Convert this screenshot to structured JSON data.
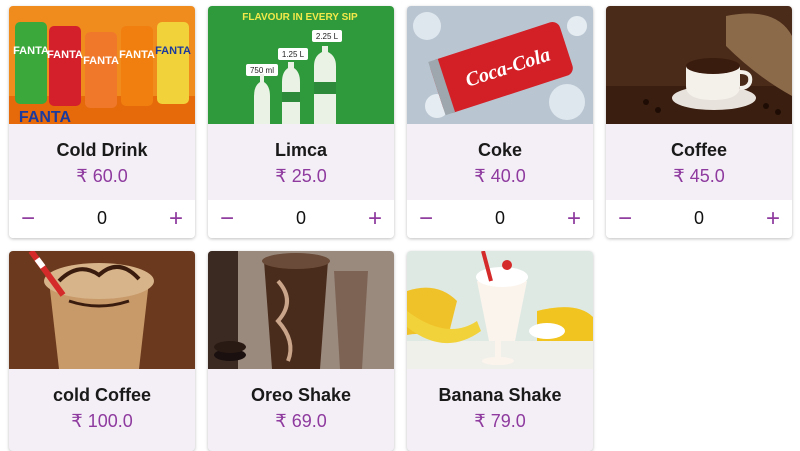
{
  "currency": "₹",
  "products": [
    {
      "name": "Cold Drink",
      "price": "₹ 60.0",
      "qty": "0",
      "image": "fanta-cans-image",
      "img_text": "FANTA"
    },
    {
      "name": "Limca",
      "price": "₹ 25.0",
      "qty": "0",
      "image": "limca-bottles-image",
      "img_text": "FLAVOUR IN EVERY SIP",
      "sizes": [
        "750 ml",
        "1.25 L",
        "2.25 L"
      ]
    },
    {
      "name": "Coke",
      "price": "₹ 40.0",
      "qty": "0",
      "image": "coca-cola-can-image",
      "img_text": "Coca-Cola"
    },
    {
      "name": "Coffee",
      "price": "₹ 45.0",
      "qty": "0",
      "image": "coffee-cup-image"
    },
    {
      "name": "cold Coffee",
      "price": "₹ 100.0",
      "image": "cold-coffee-image"
    },
    {
      "name": "Oreo Shake",
      "price": "₹ 69.0",
      "image": "oreo-shake-image"
    },
    {
      "name": "Banana Shake",
      "price": "₹ 79.0",
      "image": "banana-shake-image"
    }
  ],
  "controls": {
    "minus": "−",
    "plus": "+"
  },
  "colors": {
    "accent": "#8e3a9e",
    "card_bg": "#f4eff7"
  }
}
